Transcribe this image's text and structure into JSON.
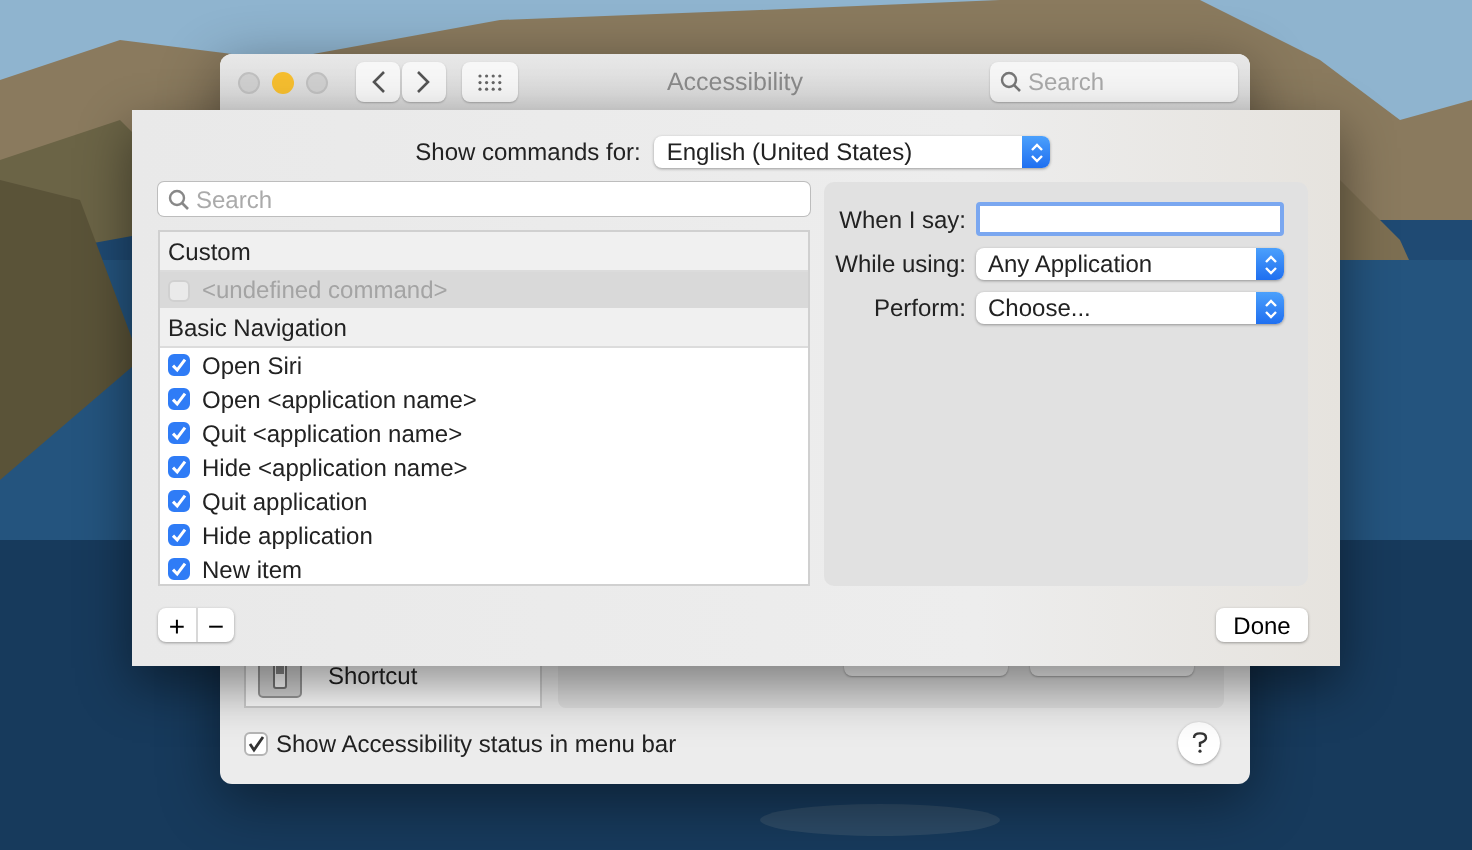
{
  "window": {
    "title": "Accessibility",
    "search_placeholder": "Search"
  },
  "background": {
    "list_item": "Shortcut",
    "status_checkbox": {
      "label": "Show Accessibility status in menu bar",
      "checked": true
    }
  },
  "sheet": {
    "language_label": "Show commands for:",
    "language": "English (United States)",
    "search_placeholder": "Search",
    "groups": [
      {
        "title": "Custom",
        "commands": [
          {
            "label": "<undefined command>",
            "checked": false,
            "disabled": true,
            "selected": true
          }
        ]
      },
      {
        "title": "Basic Navigation",
        "commands": [
          {
            "label": "Open Siri",
            "checked": true,
            "disabled": false,
            "selected": false
          },
          {
            "label": "Open <application name>",
            "checked": true,
            "disabled": false,
            "selected": false
          },
          {
            "label": "Quit <application name>",
            "checked": true,
            "disabled": false,
            "selected": false
          },
          {
            "label": "Hide <application name>",
            "checked": true,
            "disabled": false,
            "selected": false
          },
          {
            "label": "Quit application",
            "checked": true,
            "disabled": false,
            "selected": false
          },
          {
            "label": "Hide application",
            "checked": true,
            "disabled": false,
            "selected": false
          },
          {
            "label": "New item",
            "checked": true,
            "disabled": false,
            "selected": false
          }
        ]
      }
    ],
    "fields": [
      {
        "kind": "text",
        "label": "When I say:"
      },
      {
        "kind": "popup",
        "label": "While using:",
        "value": "Any Application"
      },
      {
        "kind": "popup",
        "label": "Perform:",
        "value": "Choose..."
      }
    ],
    "add_button": "+",
    "remove_button": "−",
    "done_button": "Done"
  }
}
